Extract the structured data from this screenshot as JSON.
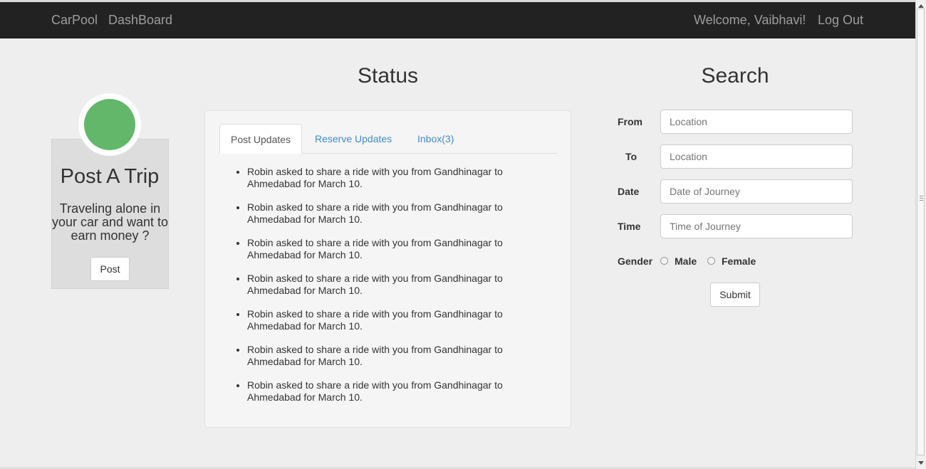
{
  "nav": {
    "brand": "CarPool",
    "dashboard": "DashBoard",
    "welcome": "Welcome, Vaibhavi!",
    "logout": "Log Out"
  },
  "post_card": {
    "title": "Post A Trip",
    "text": "Traveling alone in your car and want to earn money ?",
    "button": "Post",
    "avatar_color": "#63b76a"
  },
  "status": {
    "heading": "Status",
    "tabs": [
      {
        "label": "Post Updates",
        "active": true
      },
      {
        "label": "Reserve Updates",
        "active": false
      },
      {
        "label": "Inbox(3)",
        "active": false
      }
    ],
    "updates": [
      "Robin asked to share a ride with you from Gandhinagar to Ahmedabad for March 10.",
      "Robin asked to share a ride with you from Gandhinagar to Ahmedabad for March 10.",
      "Robin asked to share a ride with you from Gandhinagar to Ahmedabad for March 10.",
      "Robin asked to share a ride with you from Gandhinagar to Ahmedabad for March 10.",
      "Robin asked to share a ride with you from Gandhinagar to Ahmedabad for March 10.",
      "Robin asked to share a ride with you from Gandhinagar to Ahmedabad for March 10.",
      "Robin asked to share a ride with you from Gandhinagar to Ahmedabad for March 10."
    ]
  },
  "search": {
    "heading": "Search",
    "from_label": "From",
    "from_placeholder": "Location",
    "to_label": "To",
    "to_placeholder": "Location",
    "date_label": "Date",
    "date_placeholder": "Date of Journey",
    "time_label": "Time",
    "time_placeholder": "Time of Journey",
    "gender_label": "Gender",
    "male": "Male",
    "female": "Female",
    "submit": "Submit"
  },
  "colors": {
    "navbar": "#222222",
    "link": "#428bca",
    "background": "#eeeeee"
  }
}
